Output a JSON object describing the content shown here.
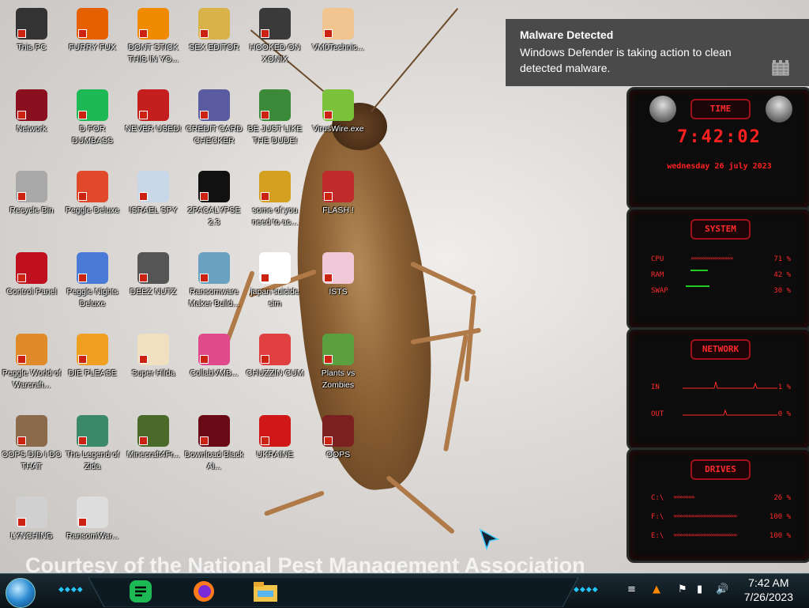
{
  "desktop": {
    "watermark": "Courtesy of the National Pest Management Association",
    "icons": [
      {
        "label": "This PC",
        "icon": "monitor-icon",
        "color": "#333333"
      },
      {
        "label": "FURRY FUX",
        "icon": "firefox-icon",
        "color": "#e66000"
      },
      {
        "label": "DONT STICK THIS IN YO...",
        "icon": "vlc-icon",
        "color": "#f08a00"
      },
      {
        "label": "SEX EDITOR",
        "icon": "hxd-icon",
        "color": "#d9b34a"
      },
      {
        "label": "HOOKED ON XONIX",
        "icon": "game-icon",
        "color": "#3a3a3a"
      },
      {
        "label": "VM0Technic...",
        "icon": "doctor-icon",
        "color": "#f2c48f"
      },
      {
        "label": "Network",
        "icon": "network-orb-icon",
        "color": "#8a1020"
      },
      {
        "label": "D FOR DUMBASS",
        "icon": "notes-icon",
        "color": "#1db954"
      },
      {
        "label": "NEVER USED!",
        "icon": "devcpp-icon",
        "color": "#c41e1e"
      },
      {
        "label": "CREDIT CARD CHECKER",
        "icon": "card-icon",
        "color": "#5a5aa0"
      },
      {
        "label": "BE JUST LIKE THE DUDE!",
        "icon": "dude-icon",
        "color": "#3a8a3a"
      },
      {
        "label": "VirusWire.exe",
        "icon": "lime-icon",
        "color": "#7ac23a"
      },
      {
        "label": "Recycle Bin",
        "icon": "recycle-bin-icon",
        "color": "#a8a8a8"
      },
      {
        "label": "Peggle Deluxe",
        "icon": "peggle-icon",
        "color": "#e04a2a"
      },
      {
        "label": "ISRAEL SPY",
        "icon": "spy-icon",
        "color": "#c8d8e8"
      },
      {
        "label": "2PACALYPSE 2.3",
        "icon": "terminal-icon",
        "color": "#111111"
      },
      {
        "label": "some of you need to ac...",
        "icon": "dog-icon",
        "color": "#d4a020"
      },
      {
        "label": "FLASH !",
        "icon": "flash-icon",
        "color": "#c02a2a"
      },
      {
        "label": "Control Panel",
        "icon": "control-panel-icon",
        "color": "#c01020"
      },
      {
        "label": "Peggle Nights Deluxe",
        "icon": "peggle-nights-icon",
        "color": "#4a7ad8"
      },
      {
        "label": "DEEZ NUTZ",
        "icon": "stack-icon",
        "color": "#555555"
      },
      {
        "label": "Ransomware Maker Build...",
        "icon": "window-icon",
        "color": "#6aa0c0"
      },
      {
        "label": "japan suicide sim",
        "icon": "flag-icon",
        "color": "#ffffff"
      },
      {
        "label": "ISTS",
        "icon": "star-icon",
        "color": "#f0c8d8"
      },
      {
        "label": "Peggle World of Warcraft...",
        "icon": "peggle-wow-icon",
        "color": "#e08a2a"
      },
      {
        "label": "DIE PLEASE",
        "icon": "de-icon",
        "color": "#f0a020"
      },
      {
        "label": "Super Hilda",
        "icon": "pixel-icon",
        "color": "#f0e0c0"
      },
      {
        "label": "CollabVMB...",
        "icon": "collab-icon",
        "color": "#e04a8a"
      },
      {
        "label": "CHUZZIN CUM",
        "icon": "chuzzle-icon",
        "color": "#e04040"
      },
      {
        "label": "Plants vs Zombies",
        "icon": "pvz-icon",
        "color": "#5aa040"
      },
      {
        "label": "OOPS DID I DO THAT",
        "icon": "portrait-icon",
        "color": "#8a6a4a"
      },
      {
        "label": "The Legend of Zida",
        "icon": "zelda-icon",
        "color": "#3a8a6a"
      },
      {
        "label": "Minecraft4Fr...",
        "icon": "minecraft-icon",
        "color": "#4a6a2a"
      },
      {
        "label": "Download Black Al...",
        "icon": "black-orb-icon",
        "color": "#6a0a18"
      },
      {
        "label": "UKRAINE",
        "icon": "radiation-icon",
        "color": "#d01818"
      },
      {
        "label": "OOPS",
        "icon": "oops-icon",
        "color": "#7a2020"
      },
      {
        "label": "LYNCHING",
        "icon": "noose-icon",
        "color": "#d0d0d0"
      },
      {
        "label": "RansomWar...",
        "icon": "skull-icon",
        "color": "#dddddd"
      }
    ]
  },
  "notification": {
    "title": "Malware Detected",
    "message": "Windows Defender is taking action to clean detected malware."
  },
  "gadgets": {
    "time": {
      "title": "TIME",
      "clock": "7:42:02",
      "date": "wednesday 26 july 2023"
    },
    "system": {
      "title": "SYSTEM",
      "rows": [
        {
          "label": "CPU",
          "value": "71 %",
          "bar": "»»»»»»»»»»»»»»"
        },
        {
          "label": "RAM",
          "value": "42 %",
          "bar": ""
        },
        {
          "label": "SWAP",
          "value": "30 %",
          "bar": ""
        }
      ]
    },
    "network": {
      "title": "NETWORK",
      "rows": [
        {
          "label": "IN",
          "value": "1 %"
        },
        {
          "label": "OUT",
          "value": "0 %"
        }
      ]
    },
    "drives": {
      "title": "DRIVES",
      "rows": [
        {
          "label": "C:\\",
          "value": "26 %",
          "bar": "»»»»»»»"
        },
        {
          "label": "F:\\",
          "value": "100 %",
          "bar": "»»»»»»»»»»»»»»»»»»»»»"
        },
        {
          "label": "E:\\",
          "value": "100 %",
          "bar": "»»»»»»»»»»»»»»»»»»»»»"
        }
      ]
    }
  },
  "taskbar": {
    "clock_time": "7:42 AM",
    "clock_date": "7/26/2023",
    "accent": "#22c8ff"
  }
}
